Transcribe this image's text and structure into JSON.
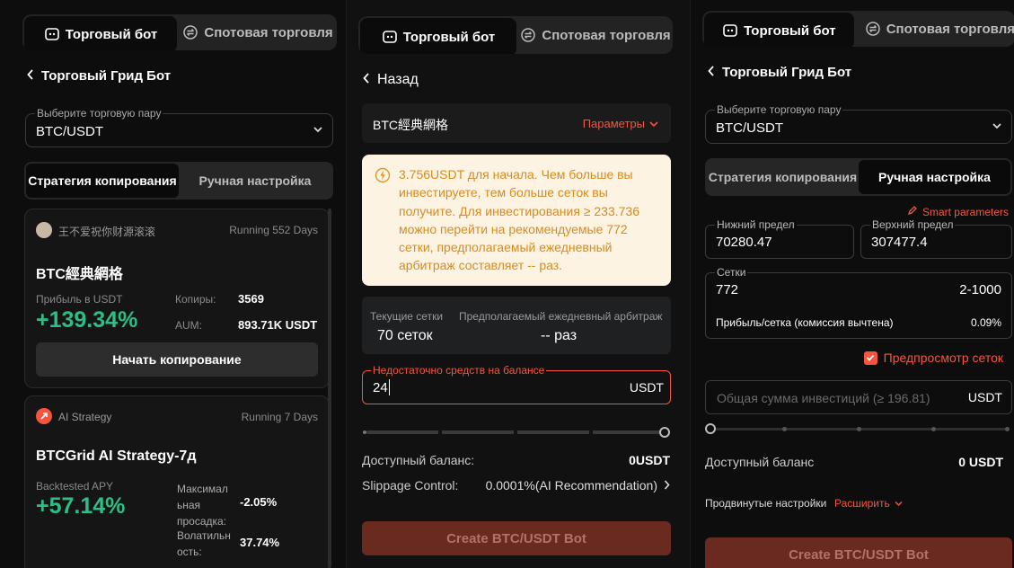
{
  "tabs": {
    "bot": "Торговый бот",
    "spot": "Спотовая торговля"
  },
  "p1": {
    "back": "Торговый Грид Бот",
    "pair_label": "Выберите торговую пару",
    "pair_value": "BTC/USDT",
    "seg_copy": "Стратегия копирования",
    "seg_manual": "Ручная настройка",
    "card1": {
      "author": "王不爱祝你财源滚滚",
      "running": "Running 552 Days",
      "title": "BTC經典網格",
      "profit_label": "Прибыль в USDT",
      "profit_value": "+139.34%",
      "copies_label": "Копиры:",
      "copies_value": "3569",
      "aum_label": "AUM:",
      "aum_value": "893.71K USDT",
      "button": "Начать копирование"
    },
    "card2": {
      "author": "AI Strategy",
      "running": "Running 7 Days",
      "title": "BTCGrid AI Strategy-7д",
      "apy_label": "Backtested APY",
      "apy_value": "+57.14%",
      "dd_label_1": "Максимал",
      "dd_label_2": "ьная",
      "dd_label_3": "просадка:",
      "dd_value": "-2.05%",
      "vol_label_1": "Волатильн",
      "vol_label_2": "ость:",
      "vol_value": "37.74%"
    }
  },
  "p2": {
    "back": "Назад",
    "strategy_name": "BTC經典網格",
    "params": "Параметры",
    "notice": "3.756USDT для начала. Чем больше вы инвестируете, тем больше сеток вы получите. Для инвестирования ≥ 233.736 можно перейти на рекомендуемые 772 сетки, предполагаемый ежедневный арбитраж составляет -- раз.",
    "cur_grids_label": "Текущие сетки",
    "cur_grids_value": "70 сеток",
    "arb_label": "Предполагаемый ежедневный арбитраж",
    "arb_value": "-- раз",
    "input_error": "Недостаточно средств на балансе",
    "input_value": "24",
    "input_unit": "USDT",
    "balance_label": "Доступный баланс:",
    "balance_value": "0USDT",
    "slippage_label": "Slippage Control:",
    "slippage_value": "0.0001%(AI Recommendation)",
    "cta": "Create BTC/USDT Bot"
  },
  "p3": {
    "back": "Торговый Грид Бот",
    "pair_label": "Выберите торговую пару",
    "pair_value": "BTC/USDT",
    "seg_copy": "Стратегия копирования",
    "seg_manual": "Ручная настройка",
    "smart": "Smart parameters",
    "low_label": "Нижний предел",
    "low_value": "70280.47",
    "high_label": "Верхний предел",
    "high_value": "307477.4",
    "grids_label": "Сетки",
    "grids_value": "772",
    "grids_range": "2-1000",
    "profit_label": "Прибыль/сетка (комиссия вычтена)",
    "profit_value": "0.09%",
    "preview": "Предпросмотр сеток",
    "invest_placeholder": "Общая сумма инвестиций (≥ 196.81)",
    "invest_unit": "USDT",
    "balance_label": "Доступный баланс",
    "balance_value": "0 USDT",
    "advanced": "Продвинутые настройки",
    "expand": "Расширить",
    "cta": "Create BTC/USDT Bot"
  },
  "colors": {
    "accent": "#f7543c",
    "green": "#2ebd85",
    "notice_bg": "#fcf3e3",
    "notice_text": "#d98b1e"
  }
}
